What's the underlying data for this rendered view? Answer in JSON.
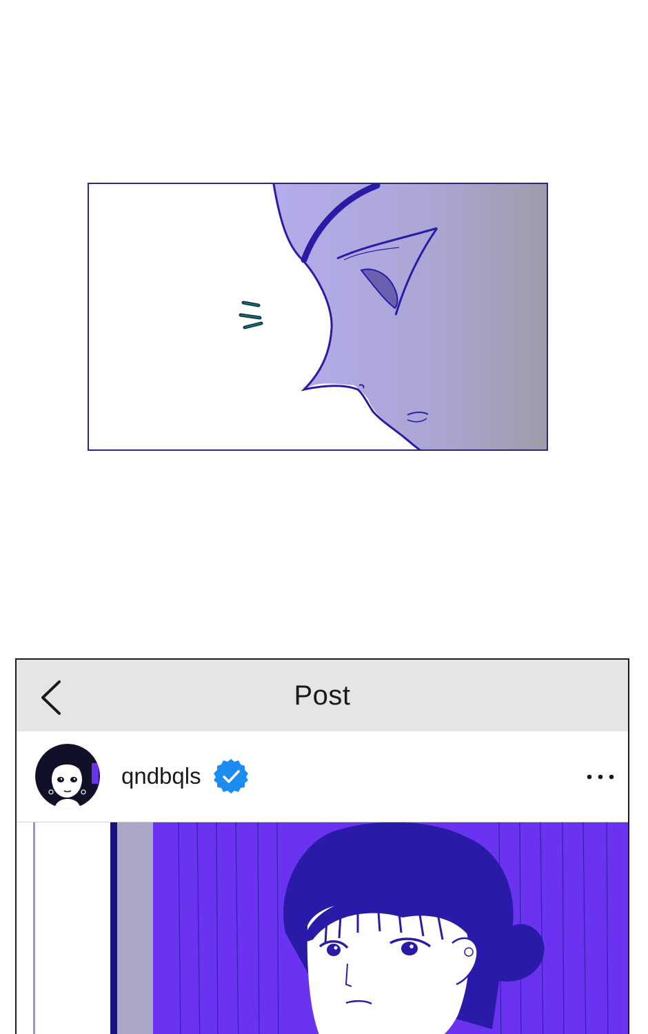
{
  "post_view": {
    "header": {
      "title": "Post",
      "back_icon": "chevron-left-icon"
    },
    "author": {
      "username": "qndbqls",
      "verified": true,
      "verified_icon": "verified-badge-icon",
      "verified_color": "#1d8cf2",
      "more_icon": "more-horizontal-icon"
    }
  },
  "colors": {
    "panel_border": "#2b2680",
    "line_art": "#2a1aa8",
    "accent_purple": "#6a33f0",
    "header_bg": "#e5e5e7"
  }
}
